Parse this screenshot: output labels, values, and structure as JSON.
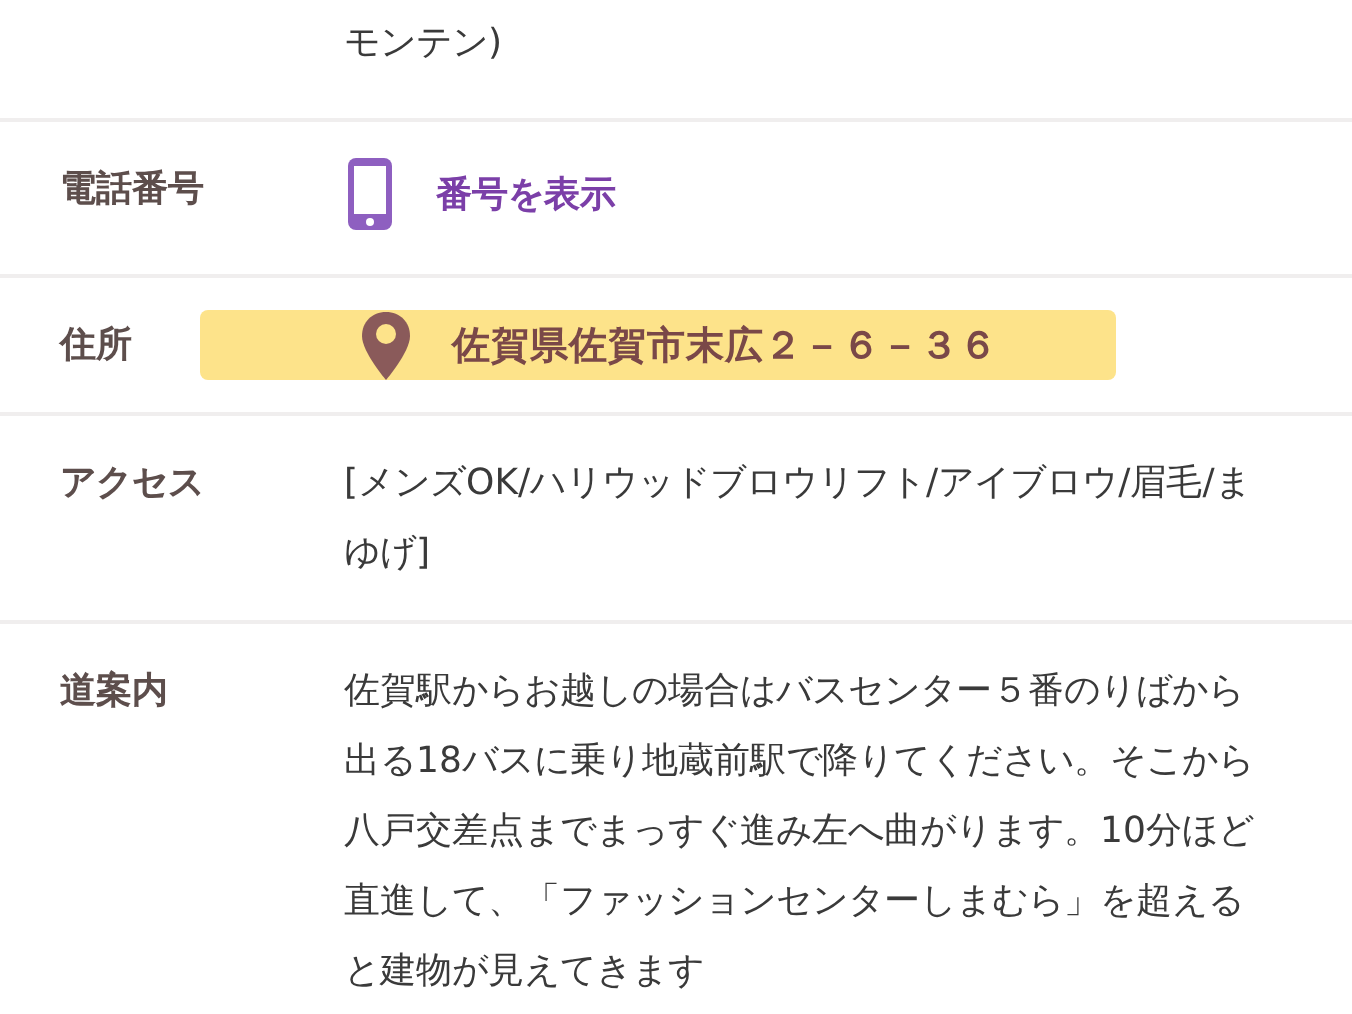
{
  "rows": [
    {
      "kind": "text",
      "label": "",
      "value": "モンテン)"
    },
    {
      "kind": "phone",
      "label": "電話番号",
      "value": "番号を表示"
    },
    {
      "kind": "address",
      "label": "住所",
      "value": "佐賀県佐賀市末広２－６－３６"
    },
    {
      "kind": "text",
      "label": "アクセス",
      "value": " [メンズOK/ハリウッドブロウリフト/アイブロウ/眉毛/まゆげ]"
    },
    {
      "kind": "text",
      "label": "道案内",
      "value": "佐賀駅からお越しの場合はバスセンター５番のりばから出る18バスに乗り地蔵前駅で降りてください。そこから八戸交差点までまっすぐ進み左へ曲がります。10分ほど直進して、「ファッションセンターしまむら」を超えると建物が見えてきます"
    }
  ]
}
